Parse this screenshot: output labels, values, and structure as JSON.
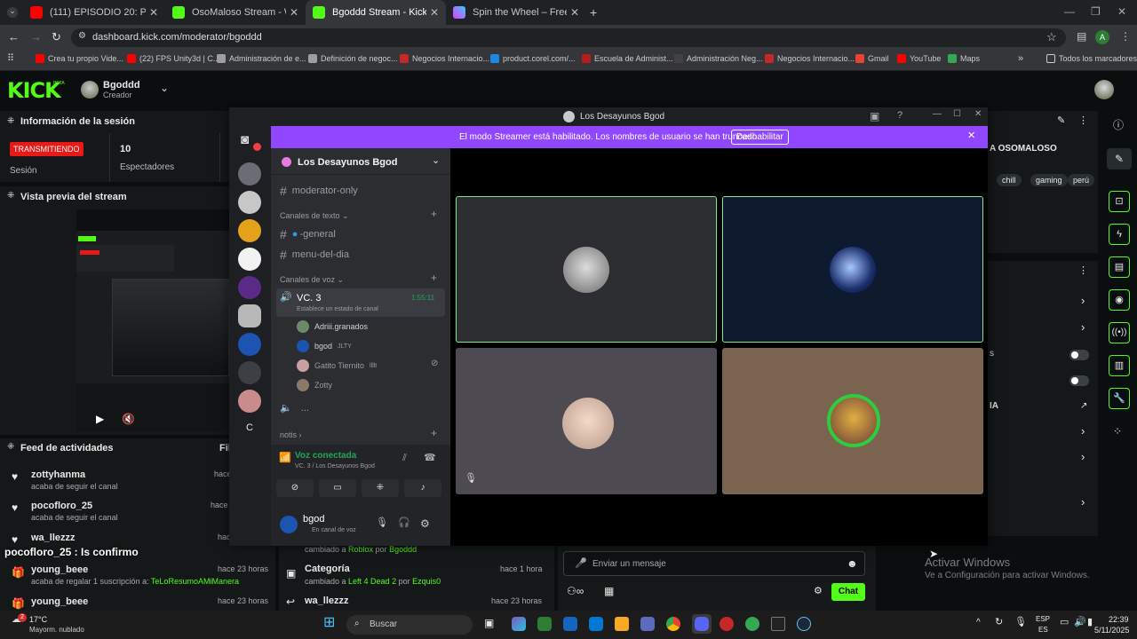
{
  "browser": {
    "tabs": [
      {
        "label": "(111) EPISODIO 20: Patricio Sald",
        "fav": "#ff0000"
      },
      {
        "label": "OsoMaloso Stream - Watch Liv",
        "fav": "#53fc18"
      },
      {
        "label": "Bgoddd Stream - Kick Dashbo",
        "fav": "#53fc18"
      },
      {
        "label": "Spin the Wheel – Free and easy",
        "fav": "#e040fb"
      }
    ],
    "url": "dashboard.kick.com/moderator/bgoddd",
    "bookmarks": [
      "Crea tu propio Vide...",
      "(22) FPS Unity3d | C...",
      "Administración de e...",
      "Definición de negoc...",
      "Negocios Internacio...",
      "product.corel.com/...",
      "Escuela de Administ...",
      "Administración Neg...",
      "Negocios Internacio...",
      "Gmail",
      "YouTube",
      "Maps"
    ],
    "all_bookmarks": "Todos los marcadores",
    "profile_initial": "A"
  },
  "kick": {
    "logo": "KICK",
    "beta": "BETA",
    "channel_name": "Bgoddd",
    "channel_role": "Creador",
    "session_title": "Información de la sesión",
    "live_badge": "TRANSMITIENDO",
    "session_label": "Sesión",
    "viewers_value": "10",
    "viewers_label": "Espectadores",
    "preview_title": "Vista previa del stream",
    "feed_title": "Feed de actividades",
    "feed_filter": "Fil",
    "feed": [
      {
        "user": "zottyhanma",
        "action": "acaba de seguir el canal",
        "time": "hace"
      },
      {
        "user": "pocofloro_25",
        "action": "acaba de seguir el canal",
        "time": "hace"
      },
      {
        "user": "wa_llezzz",
        "action": "",
        "time": "hace"
      },
      {
        "user": "young_beee",
        "action": "acaba de regalar 1 suscripción a: ",
        "target": "TeLoResumoAMiManera",
        "time": "hace 23 horas"
      },
      {
        "user": "young_beee",
        "action": "",
        "time": "hace 23 horas"
      }
    ],
    "overlay_msg": "pocofloro_25 : Is confirmo",
    "middle_feed": [
      {
        "text": "cambiado a ",
        "game": "Roblox",
        "by": " por ",
        "user": "Bgoddd",
        "time": ""
      },
      {
        "title": "Categoría",
        "text": "cambiado a ",
        "game": "Left 4 Dead 2",
        "by": " por ",
        "user": "Ezquis0",
        "time": "hace 1 hora"
      },
      {
        "title": "wa_llezzz",
        "time": "hace 23 horas"
      }
    ],
    "right_title_partial": "A OSOMALOSO",
    "tags": [
      "chill",
      "gaming",
      "perú"
    ],
    "right_partial_ia": "IA",
    "right_partial_s": "s",
    "chat_placeholder": "Enviar un mensaje",
    "chat_button": "Chat",
    "activate_title": "Activar Windows",
    "activate_sub": "Ve a Configuración para activar Windows."
  },
  "discord": {
    "window_title": "Los Desayunos Bgod",
    "streamer_text": "El modo Streamer está habilitado. Los nombres de usuario se han truncado.",
    "streamer_button": "Deshabilitar",
    "server_name": "Los Desayunos Bgod",
    "channel_top": "moderator-only",
    "text_category": "Canales de texto",
    "text_channels": [
      "-general",
      "menu-del-dia"
    ],
    "voice_category": "Canales de voz",
    "voice_channel": "VC. 3",
    "voice_time": "1:55:11",
    "voice_status": "Establece un estado de canal",
    "voice_members": [
      {
        "name": "Adriii.granados",
        "tag": ""
      },
      {
        "name": "bgod",
        "tag": "JLTY"
      },
      {
        "name": "Gatito Tiernito",
        "tag": "llllt"
      },
      {
        "name": "Zotty",
        "tag": ""
      }
    ],
    "more": "...",
    "notis": "notis",
    "voice_connected": "Voz conectada",
    "voice_connected_sub": "VC. 3 / Los Desayunos Bgod",
    "user_name": "bgod",
    "user_status": "En canal de voz",
    "server_letter": "C"
  },
  "taskbar": {
    "weather_temp": "17°C",
    "weather_desc": "Mayorm. nublado",
    "weather_badge": "2",
    "search": "Buscar",
    "lang_top": "ESP",
    "lang_bottom": "ES",
    "time": "22:39",
    "date": "5/11/2025"
  }
}
